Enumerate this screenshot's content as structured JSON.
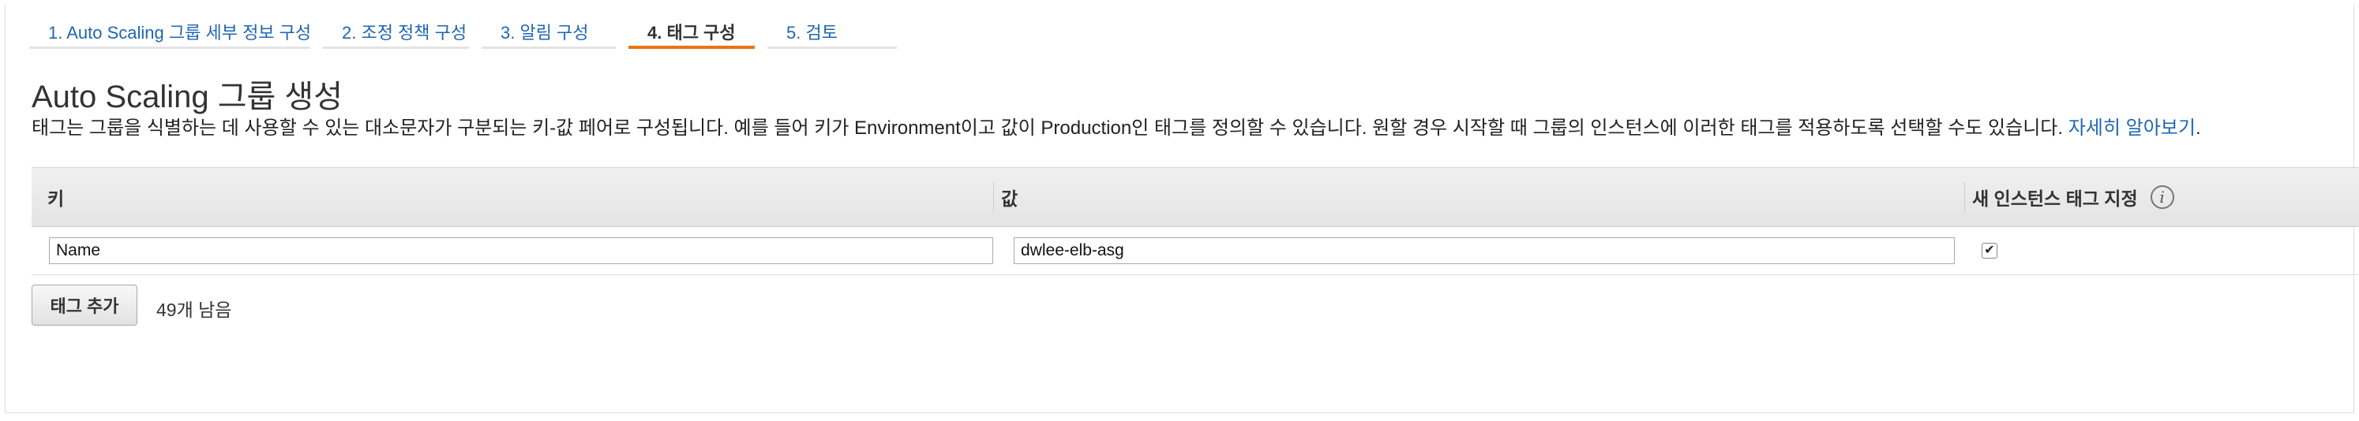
{
  "wizard": {
    "steps": [
      {
        "label": "1. Auto Scaling 그룹 세부 정보 구성",
        "active": false
      },
      {
        "label": "2. 조정 정책 구성",
        "active": false
      },
      {
        "label": "3. 알림 구성",
        "active": false
      },
      {
        "label": "4. 태그 구성",
        "active": true
      },
      {
        "label": "5. 검토",
        "active": false
      }
    ]
  },
  "page": {
    "title": "Auto Scaling 그룹 생성",
    "description": "태그는 그룹을 식별하는 데 사용할 수 있는 대소문자가 구분되는 키-값 페어로 구성됩니다. 예를 들어 키가 Environment이고 값이 Production인 태그를 정의할 수 있습니다. 원할 경우 시작할 때 그룹의 인스턴스에 이러한 태그를 적용하도록 선택할 수도 있습니다. ",
    "learn_more": "자세히 알아보기",
    "description_end": "."
  },
  "tags_table": {
    "headers": {
      "key": "키",
      "value": "값",
      "tag_new_instances": "새 인스턴스 태그 지정",
      "info_icon": "i"
    },
    "rows": [
      {
        "key": "Name",
        "value": "dwlee-elb-asg",
        "tag_new_instances": true
      }
    ]
  },
  "footer": {
    "add_tag_label": "태그 추가",
    "remaining": "49개 남음"
  },
  "colors": {
    "link": "#1f66b0",
    "active_tab_underline": "#ec7211"
  }
}
